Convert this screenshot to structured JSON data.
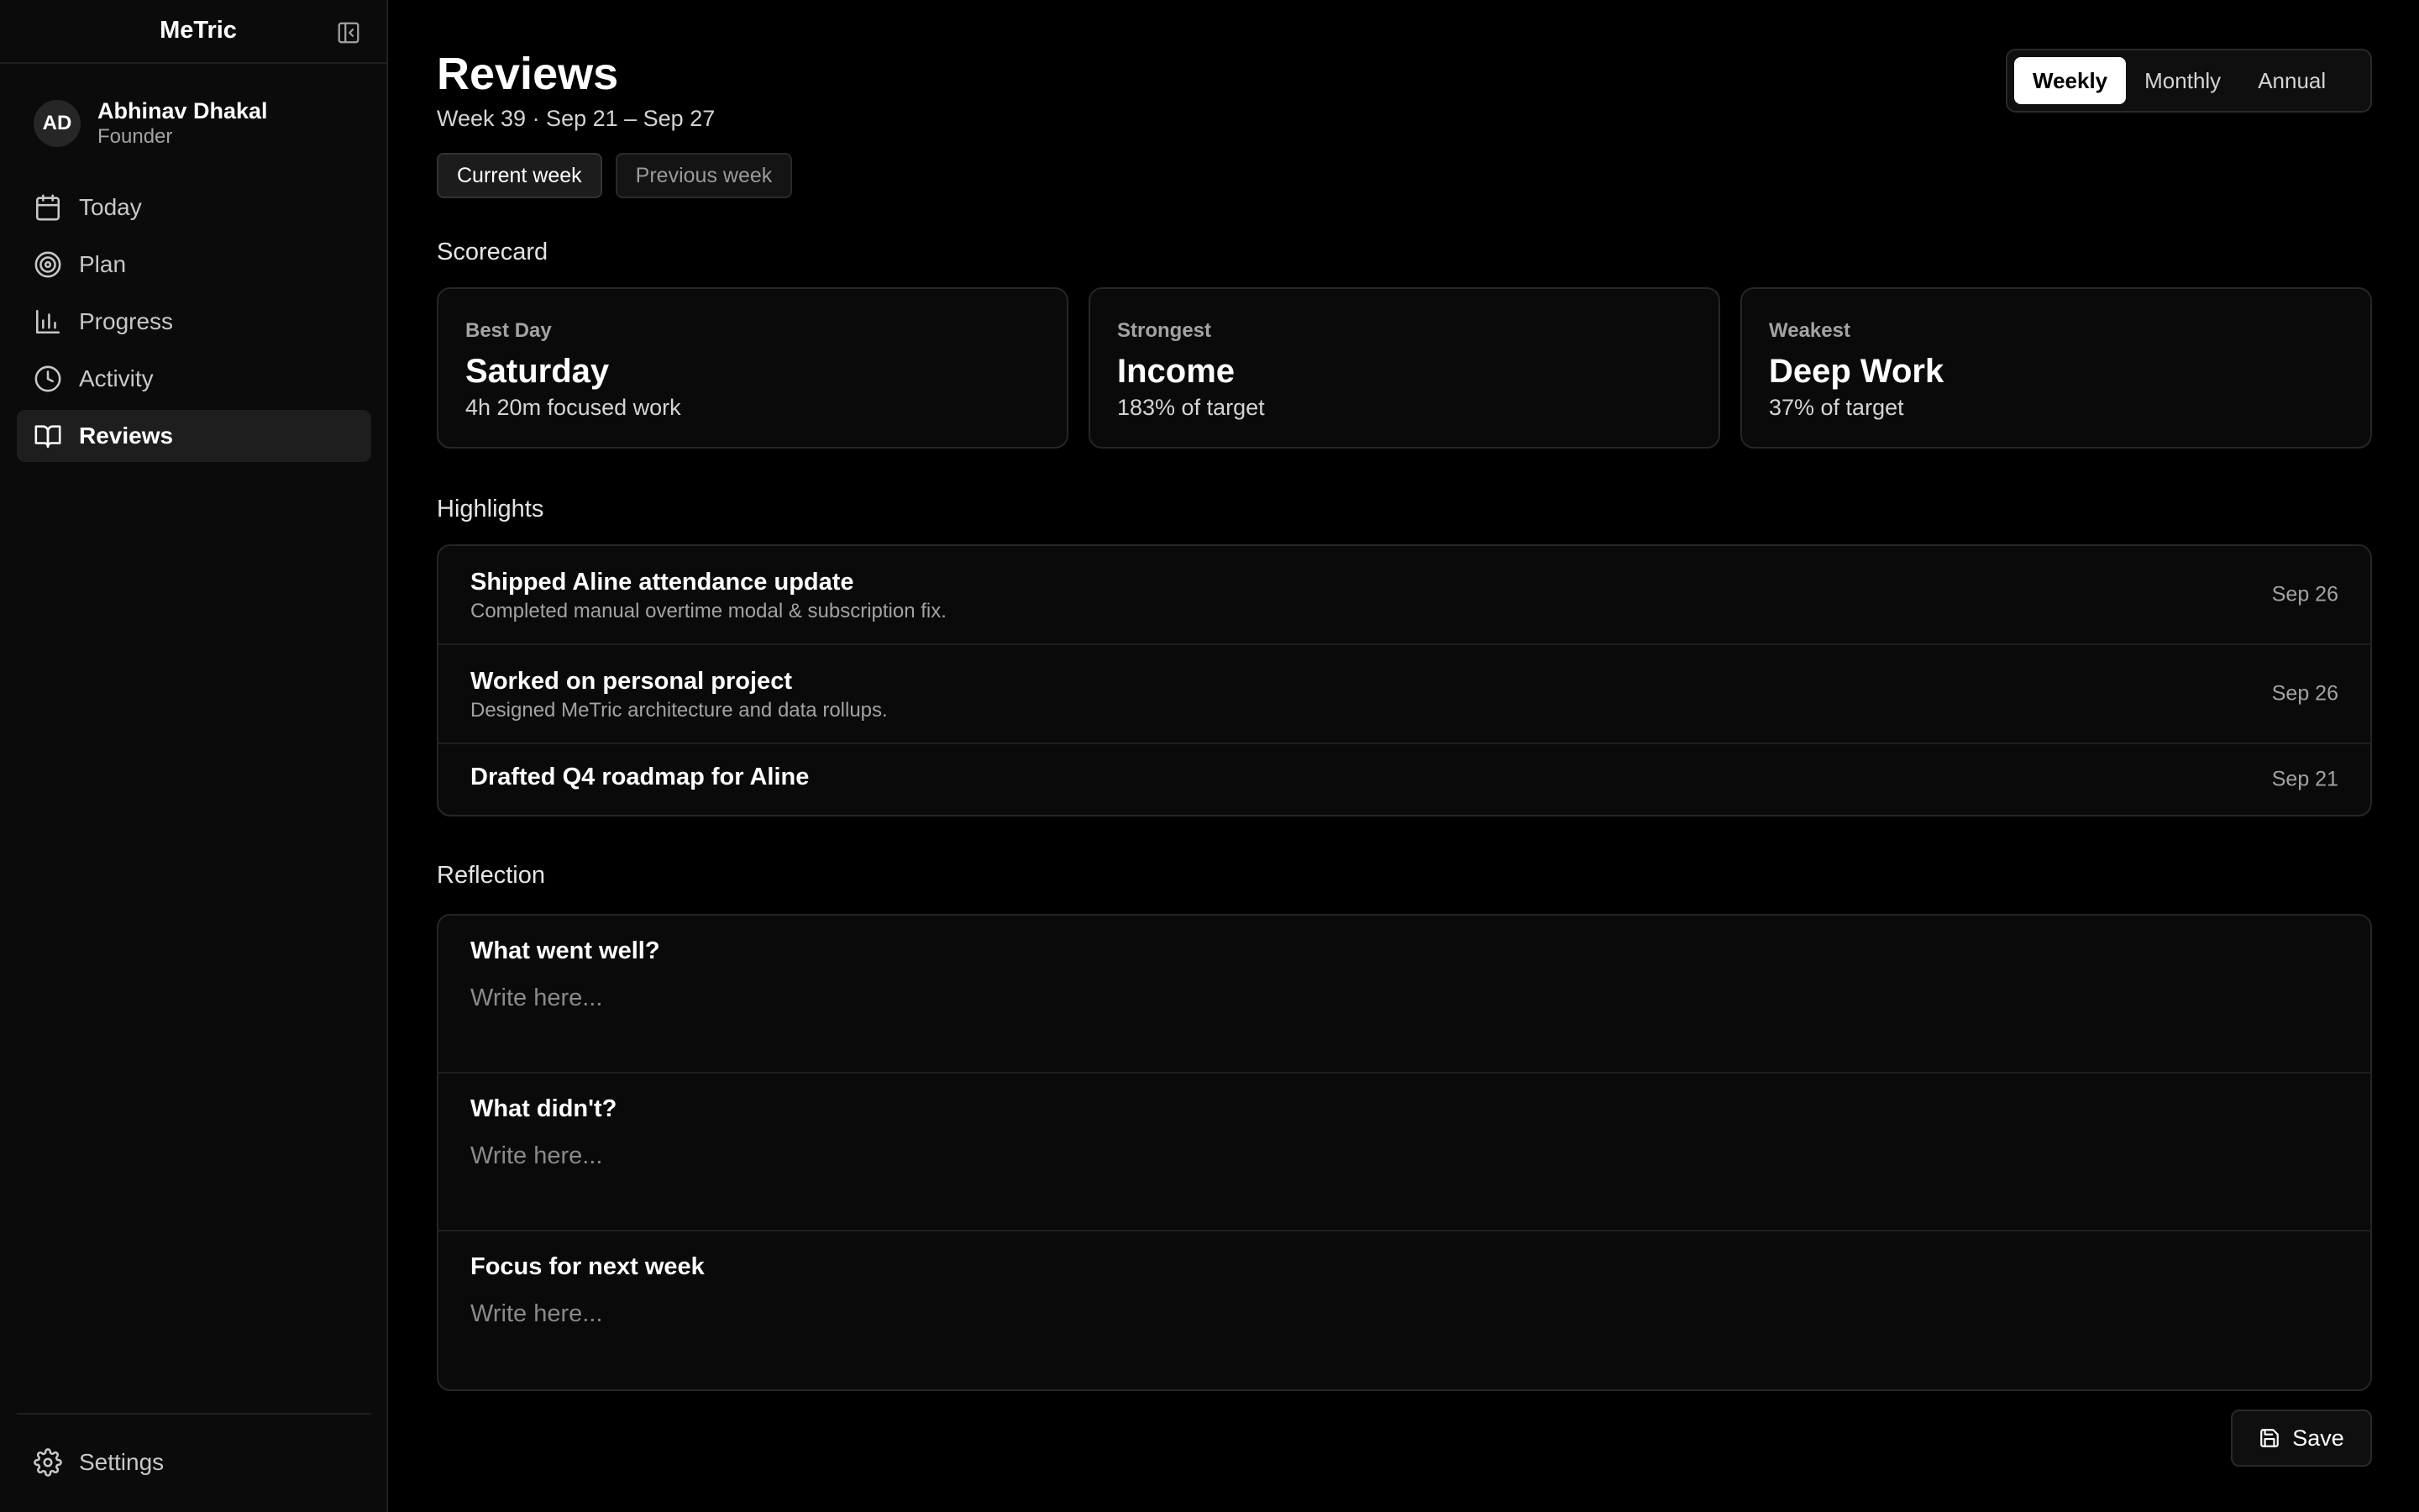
{
  "app": {
    "title": "MeTric"
  },
  "user": {
    "initials": "AD",
    "name": "Abhinav Dhakal",
    "role": "Founder"
  },
  "nav": {
    "items": [
      {
        "label": "Today",
        "icon": "calendar-icon"
      },
      {
        "label": "Plan",
        "icon": "target-icon"
      },
      {
        "label": "Progress",
        "icon": "bar-chart-icon"
      },
      {
        "label": "Activity",
        "icon": "clock-icon"
      },
      {
        "label": "Reviews",
        "icon": "book-open-icon",
        "active": true
      }
    ],
    "settings": {
      "label": "Settings",
      "icon": "gear-icon"
    }
  },
  "header": {
    "title": "Reviews",
    "subtitle": "Week 39 · Sep 21 – Sep 27",
    "week_buttons": [
      "Current week",
      "Previous week"
    ],
    "period_tabs": [
      "Weekly",
      "Monthly",
      "Annual"
    ],
    "active_period": "Weekly"
  },
  "scorecard": {
    "label": "Scorecard",
    "cards": [
      {
        "label": "Best Day",
        "value": "Saturday",
        "detail": "4h 20m focused work"
      },
      {
        "label": "Strongest",
        "value": "Income",
        "detail": "183% of target"
      },
      {
        "label": "Weakest",
        "value": "Deep Work",
        "detail": "37% of target"
      }
    ]
  },
  "highlights": {
    "label": "Highlights",
    "items": [
      {
        "title": "Shipped Aline attendance update",
        "desc": "Completed manual overtime modal & subscription fix.",
        "date": "Sep 26"
      },
      {
        "title": "Worked on personal project",
        "desc": "Designed MeTric architecture and data rollups.",
        "date": "Sep 26"
      },
      {
        "title": "Drafted Q4 roadmap for Aline",
        "desc": "",
        "date": "Sep 21"
      }
    ]
  },
  "reflection": {
    "label": "Reflection",
    "prompts": [
      {
        "question": "What went well?",
        "placeholder": "Write here..."
      },
      {
        "question": "What didn't?",
        "placeholder": "Write here..."
      },
      {
        "question": "Focus for next week",
        "placeholder": "Write here..."
      }
    ]
  },
  "actions": {
    "save_label": "Save"
  },
  "colors": {
    "background": "#000000",
    "sidebar": "#0b0b0b",
    "card": "#0a0a0a",
    "border": "#262626",
    "accent": "#ffffff"
  }
}
